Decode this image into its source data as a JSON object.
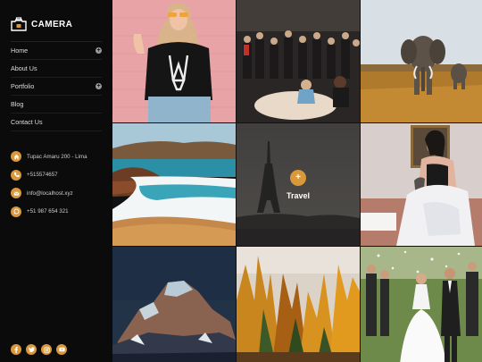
{
  "brand": {
    "name": "CAMERA",
    "accent": "#d9983a"
  },
  "nav": [
    {
      "label": "Home",
      "has_sub": true
    },
    {
      "label": "About Us",
      "has_sub": false
    },
    {
      "label": "Portfolio",
      "has_sub": true
    },
    {
      "label": "Blog",
      "has_sub": false
    },
    {
      "label": "Contact Us",
      "has_sub": false
    }
  ],
  "nav_sub_symbol": "+",
  "contact": [
    {
      "icon": "home-icon",
      "text": "Tupac Amaru 200 - Lima"
    },
    {
      "icon": "phone-icon",
      "text": "+515574657"
    },
    {
      "icon": "mail-icon",
      "text": "info@localhost.xyz"
    },
    {
      "icon": "whatsapp-icon",
      "text": "+51 987 654 321"
    }
  ],
  "social": [
    "facebook-icon",
    "twitter-icon",
    "instagram-icon",
    "youtube-icon"
  ],
  "gallery": {
    "tiles": [
      {
        "subject": "woman-pink-wall"
      },
      {
        "subject": "concert-crowd"
      },
      {
        "subject": "elephant-savanna"
      },
      {
        "subject": "beach-cliffs"
      },
      {
        "subject": "eiffel-tower",
        "hover_label": "Travel",
        "hover_symbol": "+"
      },
      {
        "subject": "woman-bed-portrait"
      },
      {
        "subject": "mountain-night"
      },
      {
        "subject": "autumn-forest"
      },
      {
        "subject": "wedding-couple"
      }
    ]
  }
}
